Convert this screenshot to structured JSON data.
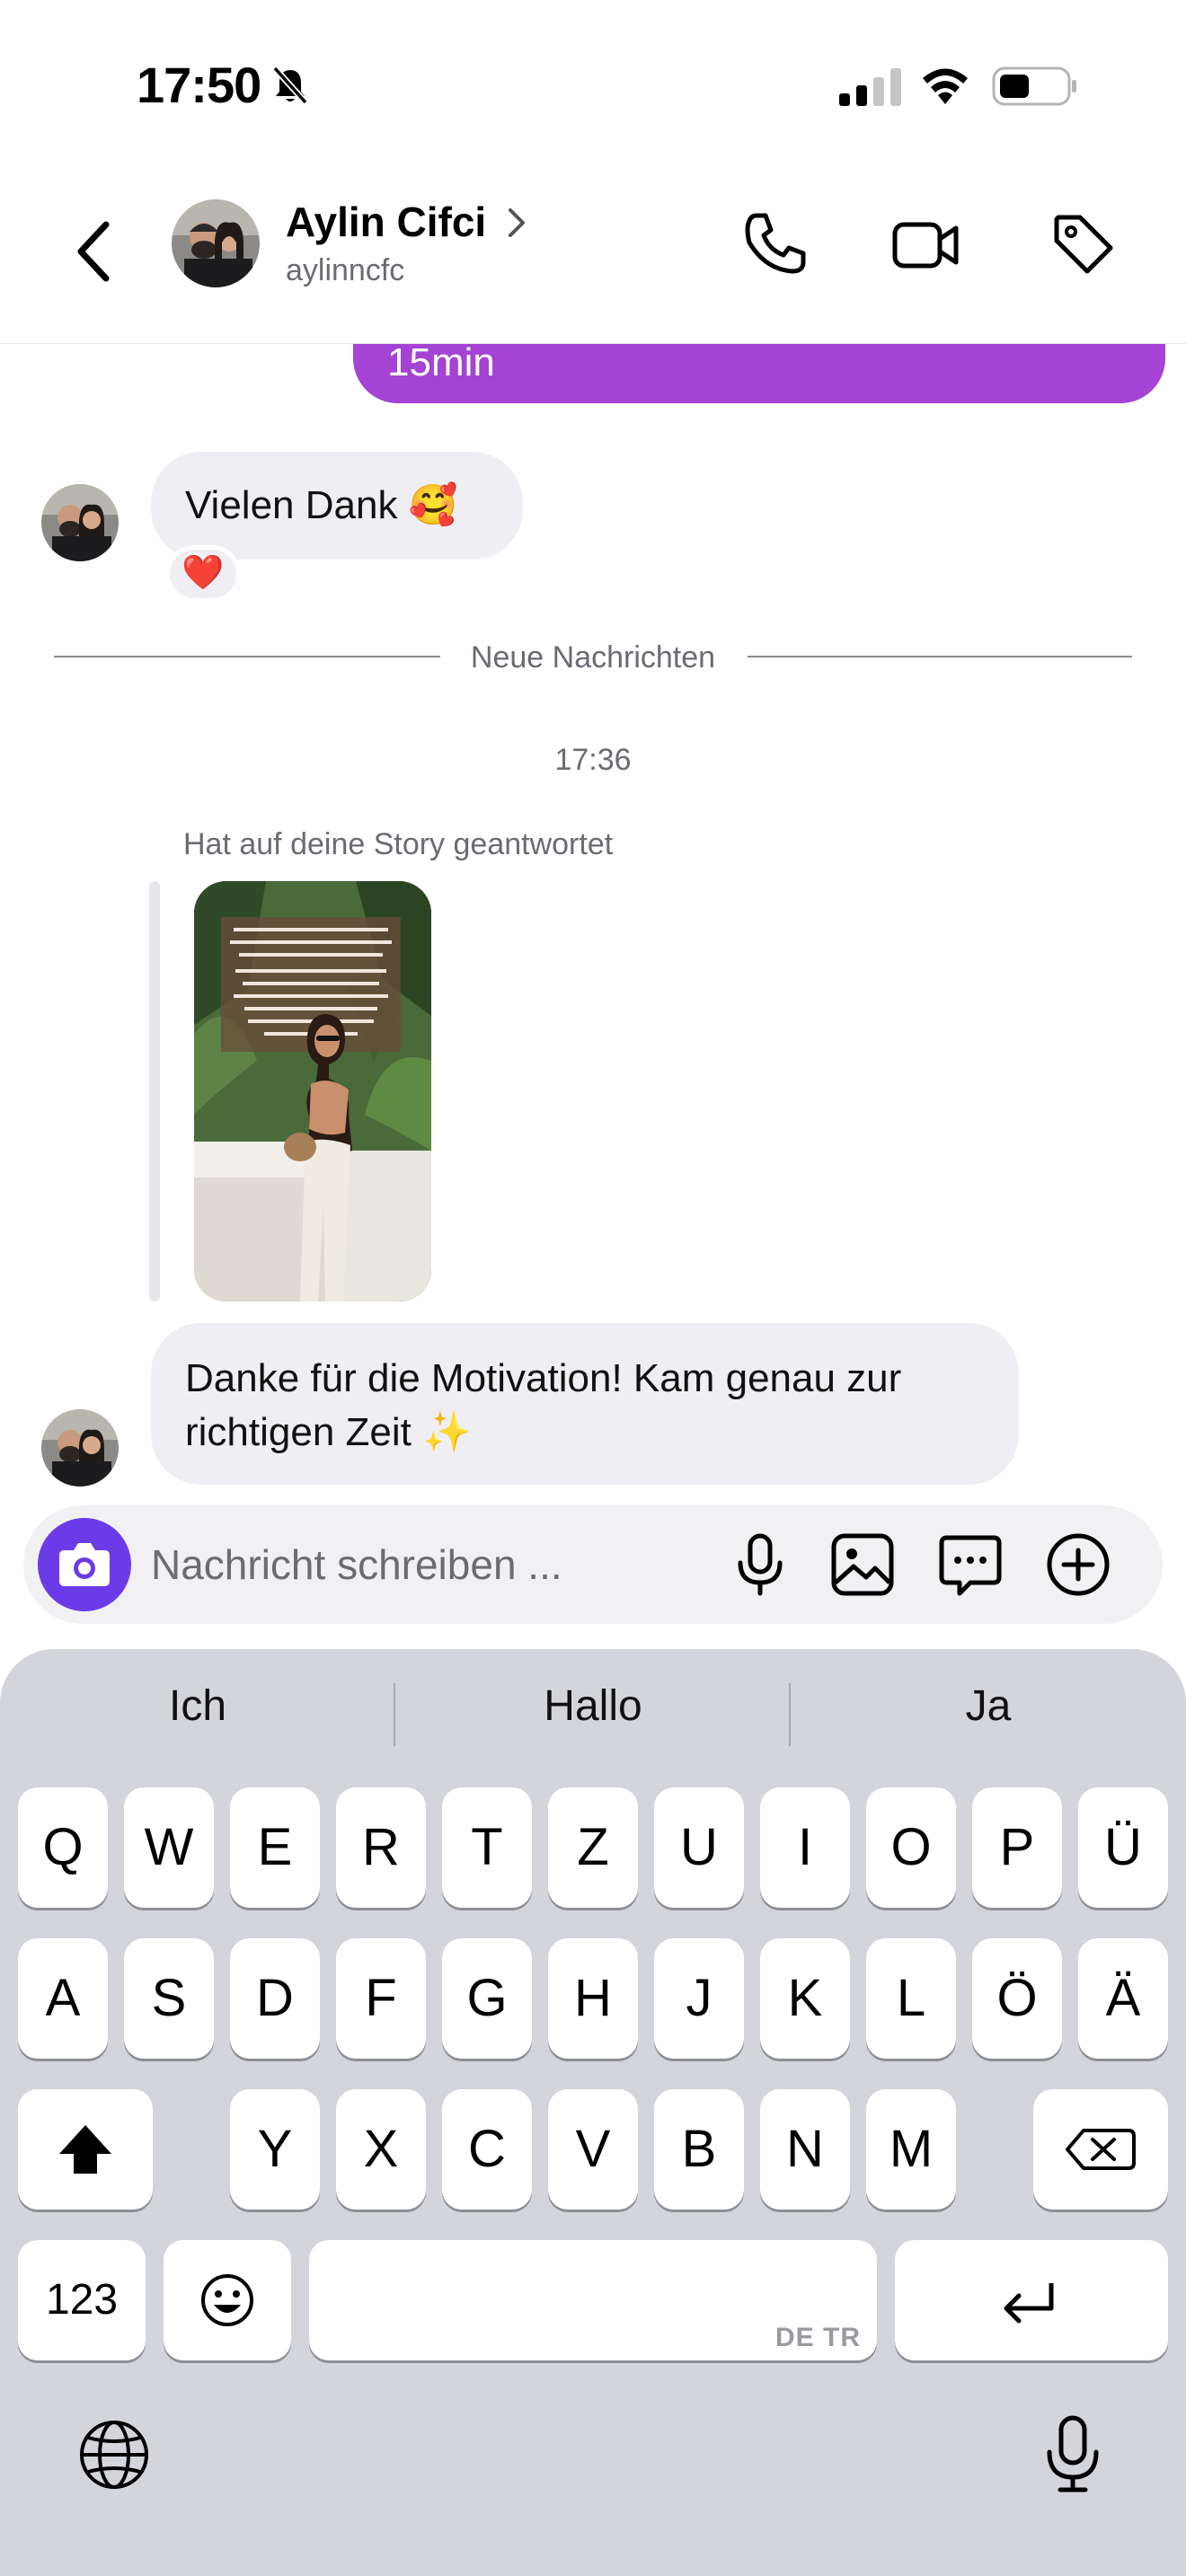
{
  "status_bar": {
    "time": "17:50"
  },
  "header": {
    "contact_name": "Aylin Cifci",
    "contact_handle": "aylinncfc"
  },
  "chat": {
    "previous_outgoing_text": "15min",
    "message1_text": "Vielen Dank 🥰",
    "message1_reaction": "❤️",
    "new_messages_divider": "Neue Nachrichten",
    "timestamp": "17:36",
    "story_reply_caption": "Hat auf deine Story geantwortet",
    "message2_text": "Danke für die Motivation! Kam genau zur richtigen Zeit ✨"
  },
  "composer": {
    "placeholder": "Nachricht schreiben ..."
  },
  "keyboard": {
    "suggestions": [
      "Ich",
      "Hallo",
      "Ja"
    ],
    "row1": [
      "Q",
      "W",
      "E",
      "R",
      "T",
      "Z",
      "U",
      "I",
      "O",
      "P",
      "Ü"
    ],
    "row2": [
      "A",
      "S",
      "D",
      "F",
      "G",
      "H",
      "J",
      "K",
      "L",
      "Ö",
      "Ä"
    ],
    "row3": [
      "Y",
      "X",
      "C",
      "V",
      "B",
      "N",
      "M"
    ],
    "numbers_key": "123",
    "space_language_hint": "DE TR"
  },
  "colors": {
    "outgoing_bubble": "#a443d4",
    "incoming_bubble": "#efeff3",
    "camera_button": "#6c3be8",
    "keyboard_bg": "#d3d5db"
  }
}
